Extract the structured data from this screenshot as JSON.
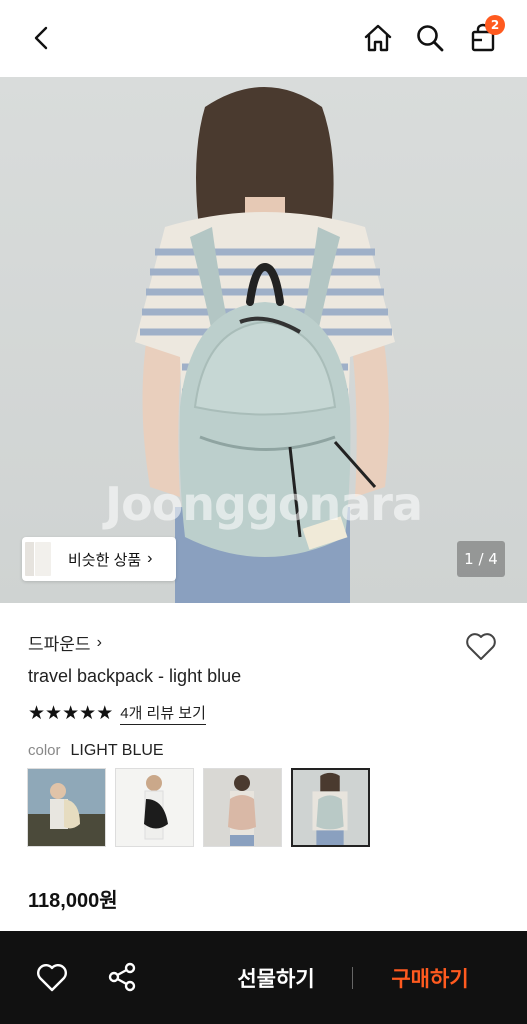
{
  "header": {
    "cart_count": "2"
  },
  "hero": {
    "watermark": "Joonggonara",
    "similar_label": "비슷한 상품",
    "pager": "1 / 4"
  },
  "product": {
    "brand": "드파운드",
    "title": "travel backpack - light blue",
    "rating_stars": 5,
    "review_link": "4개 리뷰 보기",
    "color_key": "color",
    "color_value": "LIGHT BLUE",
    "price": "118,000원",
    "swatches": [
      {
        "name": "beige",
        "color": "#e6dcc0"
      },
      {
        "name": "black",
        "color": "#1c1c1c"
      },
      {
        "name": "pink",
        "color": "#d9b8a6"
      },
      {
        "name": "light blue",
        "color": "#b9c9c6",
        "selected": true
      }
    ]
  },
  "bottom_bar": {
    "gift_label": "선물하기",
    "buy_label": "구매하기"
  },
  "colors": {
    "accent": "#ff5a1f",
    "bar_bg": "#111111"
  }
}
